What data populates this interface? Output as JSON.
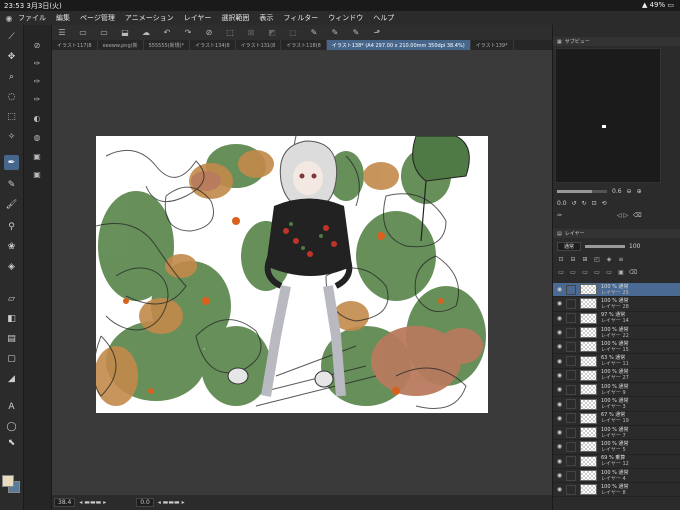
{
  "status": {
    "time": "23:53",
    "date": "3月3日(火)",
    "battery": "49%"
  },
  "menu": [
    "ファイル",
    "編集",
    "ページ管理",
    "アニメーション",
    "レイヤー",
    "選択範囲",
    "表示",
    "フィルター",
    "ウィンドウ",
    "ヘルプ"
  ],
  "tabs": [
    "イラスト117(8",
    "eeeww.png(新",
    "555555(新規)*",
    "イラスト134(8",
    "イラスト131(8",
    "イラスト118(8",
    "イラスト138* (A4 297.00 x 210.00mm 350dpi 38.4%)",
    "イラスト139*"
  ],
  "active_tab_index": 6,
  "bottom": {
    "zoom": "38.4",
    "rotation": "0.0"
  },
  "subview": {
    "title": "サブビュー"
  },
  "navigator": {
    "size_value": "0.6",
    "zoom_value": "0.0"
  },
  "layers_panel": {
    "title": "レイヤー",
    "blend_mode": "通常",
    "opacity": "100"
  },
  "layers": [
    {
      "percent_mode": "100 % 通常",
      "name": "レイヤー 25",
      "selected": true
    },
    {
      "percent_mode": "100 % 通常",
      "name": "レイヤー 28",
      "selected": false
    },
    {
      "percent_mode": "97 % 通常",
      "name": "レイヤー 14",
      "selected": false
    },
    {
      "percent_mode": "100 % 通常",
      "name": "レイヤー 22",
      "selected": false
    },
    {
      "percent_mode": "100 % 通常",
      "name": "レイヤー 15",
      "selected": false
    },
    {
      "percent_mode": "63 % 通常",
      "name": "レイヤー 11",
      "selected": false
    },
    {
      "percent_mode": "100 % 通常",
      "name": "レイヤー 27",
      "selected": false
    },
    {
      "percent_mode": "100 % 通常",
      "name": "レイヤー 9",
      "selected": false
    },
    {
      "percent_mode": "100 % 通常",
      "name": "レイヤー 3",
      "selected": false
    },
    {
      "percent_mode": "67 % 通常",
      "name": "レイヤー 19",
      "selected": false
    },
    {
      "percent_mode": "100 % 通常",
      "name": "レイヤー 7",
      "selected": false
    },
    {
      "percent_mode": "100 % 通常",
      "name": "レイヤー 5",
      "selected": false
    },
    {
      "percent_mode": "69 % 乗算",
      "name": "レイヤー 12",
      "selected": false
    },
    {
      "percent_mode": "100 % 通常",
      "name": "レイヤー 4",
      "selected": false
    },
    {
      "percent_mode": "100 % 通常",
      "name": "レイヤー 8",
      "selected": false
    }
  ],
  "colors": {
    "accent": "#47668c",
    "main_color": "#e8dcc0",
    "sub_color": "#5a7a9a"
  },
  "toolbar_icons": [
    "menu-icon",
    "new-file-icon",
    "open-file-icon",
    "save-icon",
    "cloud-icon",
    "undo-icon",
    "redo-icon",
    "clear-icon",
    "selection-icon",
    "transform-icon",
    "fill-icon",
    "ruler-icon",
    "pen-settings-icon",
    "brush-size-icon",
    "eraser-icon",
    "export-icon"
  ],
  "left_tool_icons": [
    "eye-dropper-icon",
    "move-icon",
    "zoom-icon",
    "lasso-icon",
    "select-icon",
    "magic-wand-icon",
    "pen-icon",
    "pencil-icon",
    "brush-icon",
    "airbrush-icon",
    "decoration-icon",
    "eraser-icon",
    "blend-icon",
    "fill-icon",
    "gradient-icon",
    "figure-icon",
    "text-icon",
    "balloon-icon",
    "correct-line-icon"
  ]
}
